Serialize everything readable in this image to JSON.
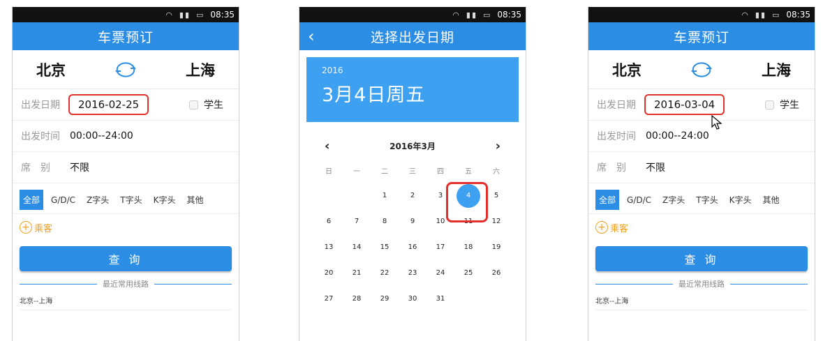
{
  "status_time": "08:35",
  "screen1": {
    "title": "车票预订",
    "from_city": "北京",
    "to_city": "上海",
    "date_label": "出发日期",
    "date_value": "2016-02-25",
    "student_label": "学生",
    "time_label": "出发时间",
    "time_value": "00:00--24:00",
    "seat_label": "席　别",
    "seat_value": "不限",
    "tabs": [
      "全部",
      "G/D/C",
      "Z字头",
      "T字头",
      "K字头",
      "其他"
    ],
    "passenger_label": "乘客",
    "query_label": "查 询",
    "recent_label": "最近常用线路",
    "recent_route": "北京--上海"
  },
  "screen2": {
    "title": "选择出发日期",
    "year": "2016",
    "selected_day_text": "3月4日周五",
    "month_label": "2016年3月",
    "weekdays": [
      "日",
      "一",
      "二",
      "三",
      "四",
      "五",
      "六"
    ],
    "weeks": [
      [
        "",
        "",
        "1",
        "2",
        "3",
        "4",
        "5"
      ],
      [
        "6",
        "7",
        "8",
        "9",
        "10",
        "11",
        "12"
      ],
      [
        "13",
        "14",
        "15",
        "16",
        "17",
        "18",
        "19"
      ],
      [
        "20",
        "21",
        "22",
        "23",
        "24",
        "25",
        "26"
      ],
      [
        "27",
        "28",
        "29",
        "30",
        "31",
        "",
        ""
      ]
    ],
    "selected": "4"
  },
  "screen3": {
    "title": "车票预订",
    "from_city": "北京",
    "to_city": "上海",
    "date_label": "出发日期",
    "date_value": "2016-03-04",
    "student_label": "学生",
    "time_label": "出发时间",
    "time_value": "00:00--24:00",
    "seat_label": "席　别",
    "seat_value": "不限",
    "tabs": [
      "全部",
      "G/D/C",
      "Z字头",
      "T字头",
      "K字头",
      "其他"
    ],
    "passenger_label": "乘客",
    "query_label": "查 询",
    "recent_label": "最近常用线路",
    "recent_route": "北京--上海"
  },
  "colors": {
    "primary": "#2b8de3",
    "calendar_blue": "#3ea0f1",
    "highlight_red": "#e3302c",
    "passenger_orange": "#f0a020"
  },
  "icons": [
    "wifi-icon",
    "signal-icon",
    "battery-icon",
    "swap-icon",
    "back-icon",
    "plus-icon",
    "cursor-icon"
  ]
}
